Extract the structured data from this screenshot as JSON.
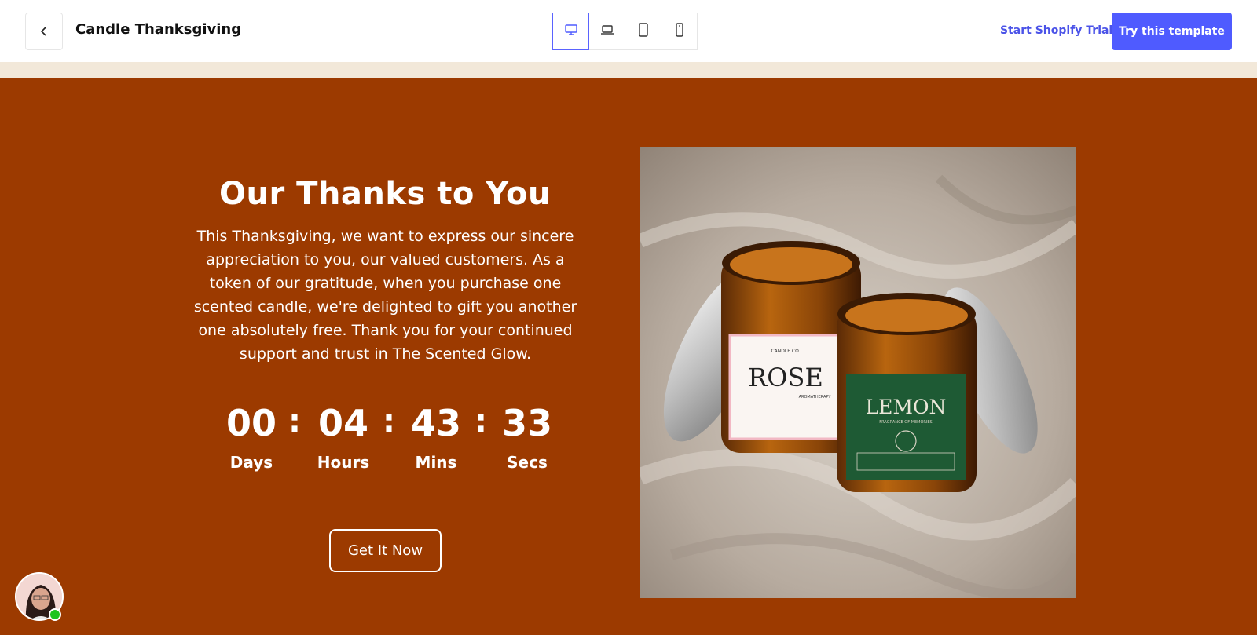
{
  "header": {
    "title": "Candle Thanksgiving",
    "trial_link": "Start Shopify Trial",
    "try_button": "Try this template",
    "accent": "#4f5bff",
    "icons": [
      "chevron-left-icon",
      "desktop-icon",
      "laptop-icon",
      "tablet-icon",
      "mobile-icon"
    ]
  },
  "hero": {
    "background": "#9c3a00",
    "heading": "Our Thanks to You",
    "body_lines": [
      "This Thanksgiving, we want to express our sincere",
      "appreciation to you, our valued customers. As a",
      "token of our gratitude, when you purchase one",
      "scented candle, we're delighted to gift you another",
      "one absolutely free. Thank you for your continued",
      "support and trust in The Scented Glow."
    ],
    "countdown": {
      "days": "00",
      "hours": "04",
      "mins": "43",
      "secs": "33",
      "separator": ":",
      "labels": {
        "days": "Days",
        "hours": "Hours",
        "mins": "Mins",
        "secs": "Secs"
      }
    },
    "cta": "Get It Now"
  },
  "product_image": {
    "jar1_label": "ROSE",
    "jar1_brand": "CANDLE CO.",
    "jar1_sub": "AROMATHERAPY",
    "jar2_label": "LEMON",
    "jar2_sub": "FRAGRANCE OF MEMORIES"
  }
}
